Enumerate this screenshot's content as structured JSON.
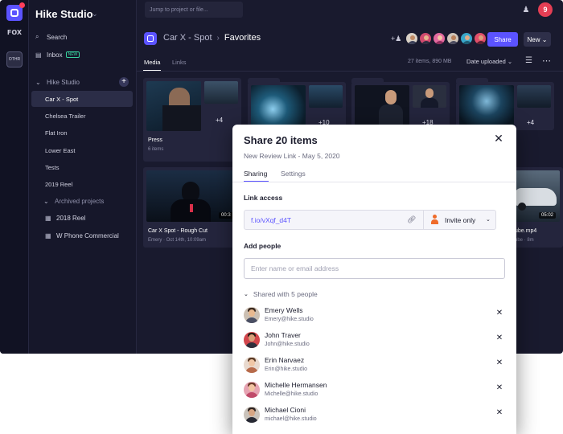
{
  "rail": {
    "team_logo_text": "FOX",
    "team_tile_text": "OTHR"
  },
  "sidebar": {
    "workspace": "Hike Studio",
    "nav": [
      {
        "label": "Search",
        "icon": "search-icon"
      },
      {
        "label": "Inbox",
        "icon": "inbox-icon",
        "badge": "NEW"
      }
    ],
    "team": "Hike Studio",
    "projects": [
      "Car X - Spot",
      "Chelsea Trailer",
      "Flat Iron",
      "Lower East",
      "Tests",
      "2019 Reel"
    ],
    "archived_label": "Archived projects",
    "archived": [
      "2018 Reel",
      "W Phone Commercial"
    ],
    "active_project": "Car X - Spot"
  },
  "topbar": {
    "search_placeholder": "Jump to project or file...",
    "user_initial": "9"
  },
  "header": {
    "project": "Car X - Spot",
    "folder": "Favorites",
    "share_label": "Share",
    "new_label": "New"
  },
  "tabs": {
    "media": "Media",
    "links": "Links"
  },
  "summary": {
    "count": "27 items, 890 MB",
    "sort": "Date uploaded"
  },
  "cards": [
    {
      "name": "Press",
      "meta": "6 items",
      "plus": "+4"
    },
    {
      "plus": "+10"
    },
    {
      "plus": "+18"
    },
    {
      "plus": "+4"
    },
    {
      "name": "Car X Spot - Rough Cut",
      "meta": "Emery · Oct 14th, 10:09am",
      "duration": "00:3"
    },
    {
      "name": "ube.mp4",
      "meta": "ube · 8m",
      "duration": "05:02"
    }
  ],
  "modal": {
    "title": "Share 20 items",
    "subtitle": "New Review Link - May 5, 2020",
    "tab_sharing": "Sharing",
    "tab_settings": "Settings",
    "link_access_label": "Link access",
    "link_url": "f.io/vXqf_d4T",
    "invite_mode": "Invite only",
    "add_people_label": "Add people",
    "add_people_placeholder": "Enter name or email address",
    "shared_with": "Shared with 5 people",
    "people": [
      {
        "name": "Emery Wells",
        "email": "Emery@hike.studio"
      },
      {
        "name": "John Traver",
        "email": "John@hike.studio"
      },
      {
        "name": "Erin Narvaez",
        "email": "Erin@hike.studio"
      },
      {
        "name": "Michelle Hermansen",
        "email": "Michelle@hike.studio"
      },
      {
        "name": "Michael Cioni",
        "email": "michael@hike.studio"
      }
    ]
  },
  "colors": {
    "accent": "#5b53ff",
    "app_bg": "#191a2e",
    "alert": "#e53e54",
    "invite": "#ef6b2a"
  }
}
